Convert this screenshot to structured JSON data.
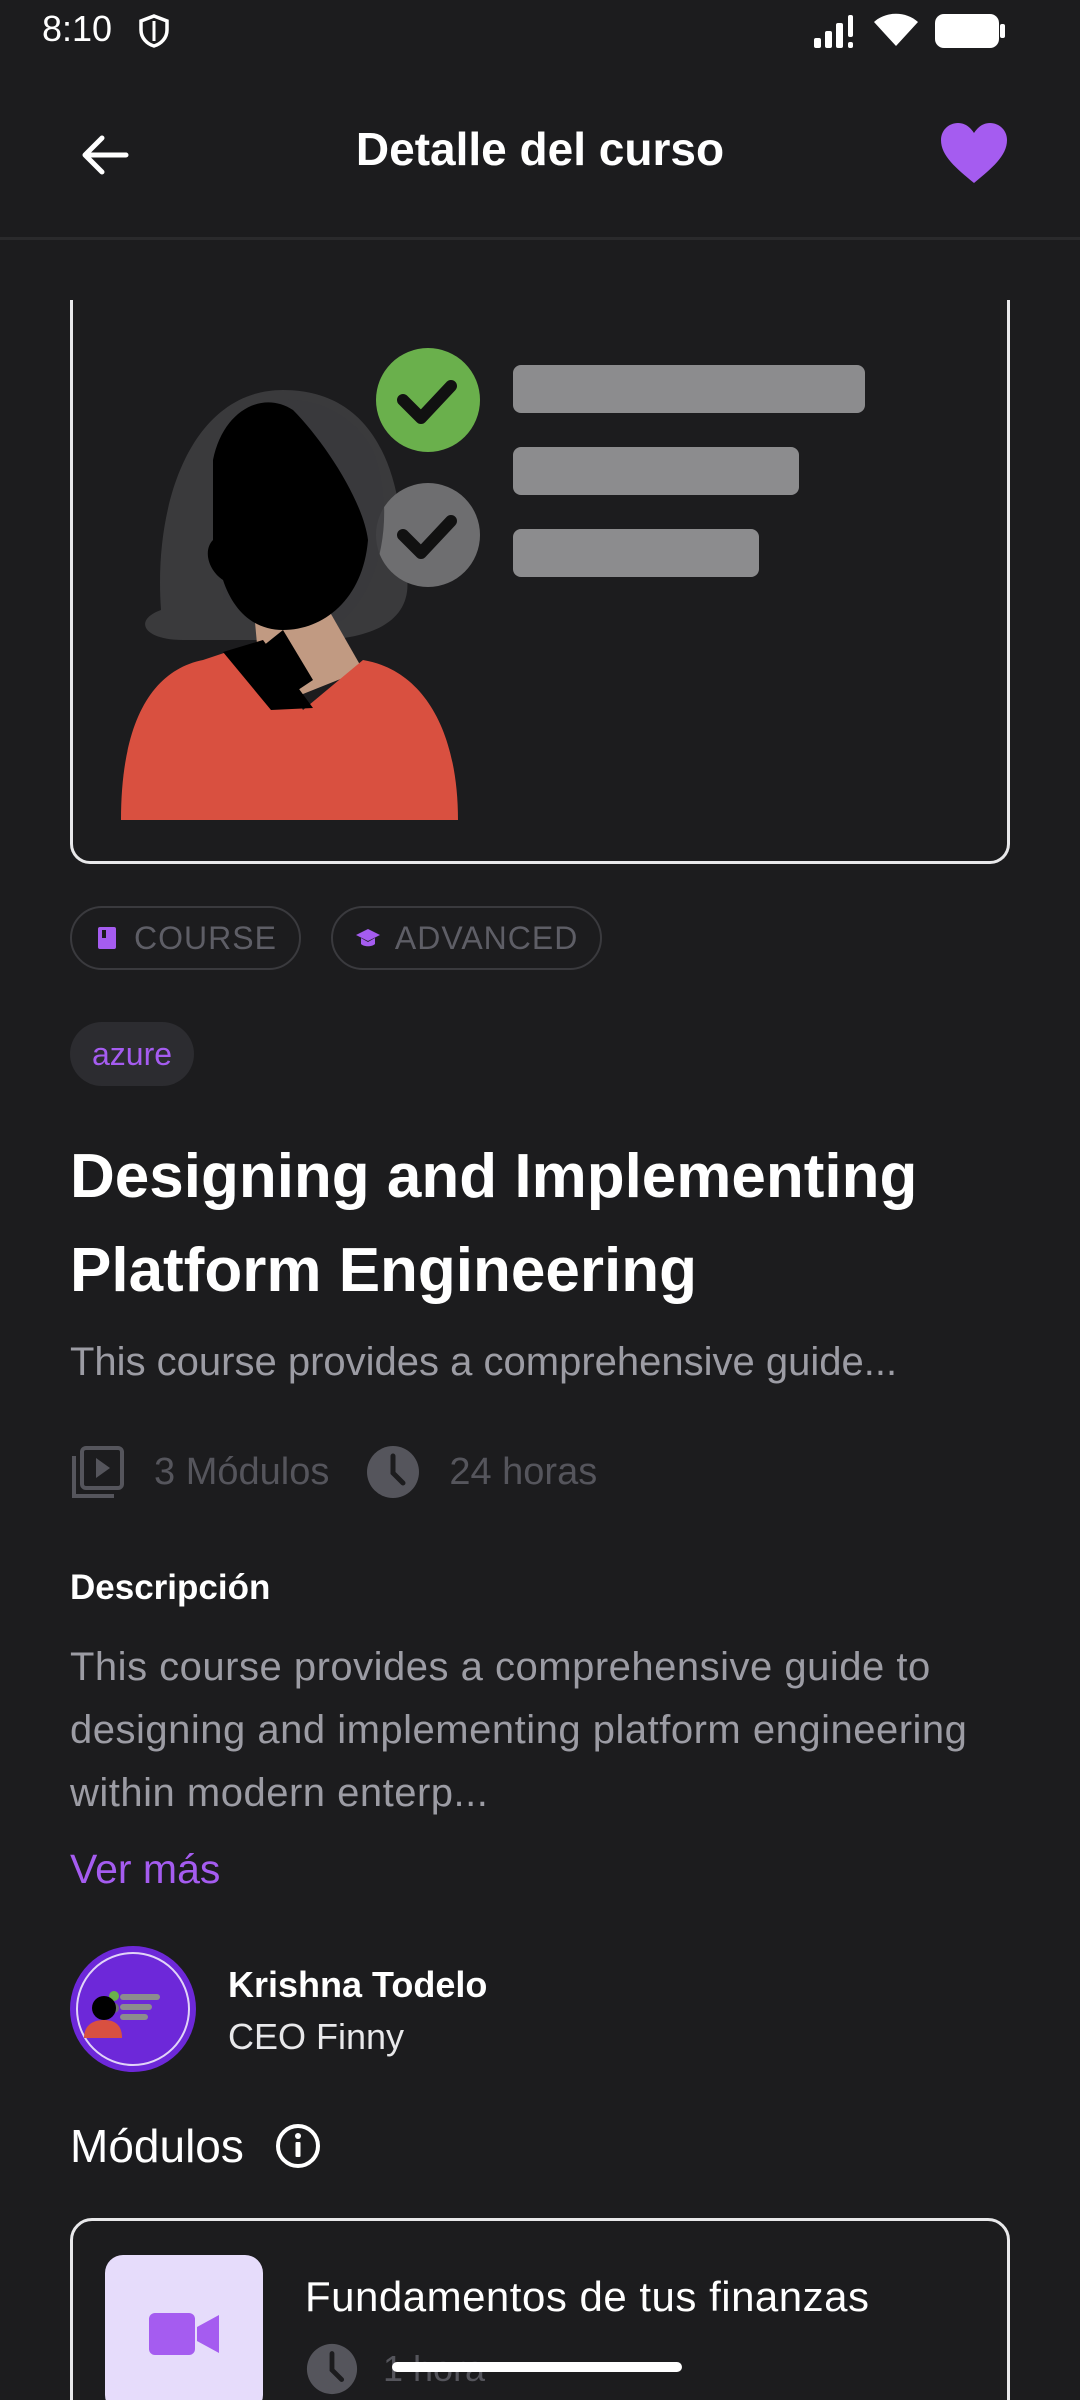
{
  "status_bar": {
    "time": "8:10",
    "icons": [
      "shield-icon",
      "signal-icon",
      "wifi-icon",
      "battery-icon"
    ]
  },
  "app_bar": {
    "title": "Detalle del curso",
    "back_icon": "arrow-left-icon",
    "favorite_icon": "heart-icon",
    "favorite_color": "#a55cf0"
  },
  "course": {
    "chips": [
      {
        "icon": "book-icon",
        "label": "COURSE"
      },
      {
        "icon": "graduation-cap-icon",
        "label": "ADVANCED"
      }
    ],
    "tag": "azure",
    "title": "Designing and Implementing Platform Engineering",
    "subtitle": "This course provides a comprehensive guide...",
    "modules_count": "3 Módulos",
    "duration": "24 horas"
  },
  "description": {
    "heading": "Descripción",
    "body": "This course provides a comprehensive guide to designing and implementing platform engineering within modern enterp...",
    "see_more": "Ver más"
  },
  "author": {
    "name": "Krishna Todelo",
    "role": "CEO Finny"
  },
  "modules": {
    "heading": "Módulos",
    "items": [
      {
        "title": "Fundamentos de tus finanzas",
        "duration": "1 hora",
        "icon": "video-camera-icon"
      }
    ]
  },
  "colors": {
    "accent": "#a55cf0",
    "background": "#1c1c1e",
    "muted_text": "#9c9ca4"
  }
}
